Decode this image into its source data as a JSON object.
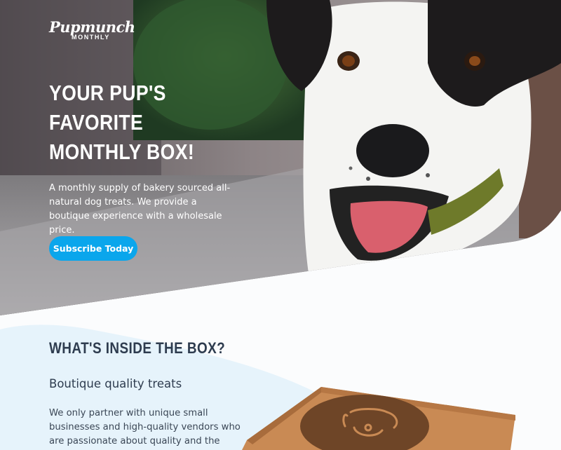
{
  "brand": {
    "name": "Pupmunch",
    "tagline": "MONTHLY"
  },
  "hero": {
    "headline": [
      "YOUR PUP'S",
      "FAVORITE",
      "MONTHLY BOX!"
    ],
    "description": "A monthly supply of bakery sourced all-natural dog treats. We provide a boutique experience with a wholesale price.",
    "cta_label": "Subscribe Today"
  },
  "section": {
    "title": "WHAT'S INSIDE THE BOX?",
    "subtitle": "Boutique quality treats",
    "body": "We only partner with unique small businesses and high-quality vendors who are passionate about quality and the"
  },
  "colors": {
    "accent": "#0aa6ec",
    "heading": "#2e3c4f",
    "box": "#c98a54",
    "box_emblem": "#6e4527"
  }
}
